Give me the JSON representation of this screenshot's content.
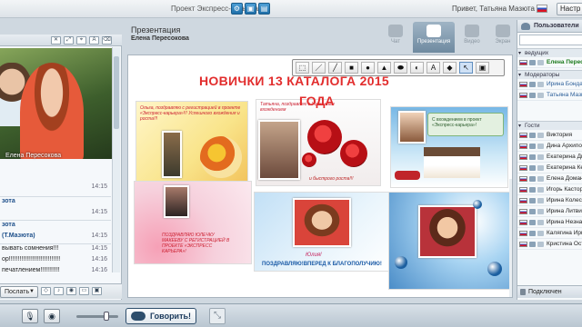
{
  "topbar": {
    "project": "Проект Экспресс-карьера",
    "greeting": "Привет, Татьяна Мазюта",
    "settings_label": "Настр",
    "buttons": [
      "gear-icon",
      "save-icon",
      "window-icon"
    ]
  },
  "left": {
    "video_caption": "Елена Пересокова",
    "send_label": "Послать",
    "chat": [
      {
        "text": "14:15",
        "kind": "time"
      },
      {
        "text": "зота",
        "kind": "b",
        "time": ""
      },
      {
        "text": "",
        "kind": "plain",
        "time": "14:15"
      },
      {
        "text": "зота",
        "kind": "b",
        "time": ""
      },
      {
        "text": "(Т.Мазюта)",
        "kind": "b",
        "time": "14:15"
      },
      {
        "text": "вывать сомнения!!!",
        "kind": "plain",
        "time": "14:15"
      },
      {
        "text": "ор!!!!!!!!!!!!!!!!!!!!!!!!!!!!!",
        "kind": "plain",
        "time": "14:16"
      },
      {
        "text": "печатлением!!!!!!!!!!!",
        "kind": "plain",
        "time": "14:16"
      }
    ]
  },
  "center": {
    "title": "Презентация",
    "presenter": "Елена Пересокова",
    "tabs": [
      {
        "label": "Чат",
        "icon": "chat-icon"
      },
      {
        "label": "Презентация",
        "icon": "presentation-icon"
      },
      {
        "label": "Видео",
        "icon": "video-icon"
      },
      {
        "label": "Экран",
        "icon": "screen-icon"
      }
    ],
    "headline": "НОВИЧКИ 13  КАТАЛОГА 2015",
    "headline2": "ГОДА",
    "card2_text": "Татьяна, поздравляю с Успешным вхождением",
    "card2_caption": "и быстрого роста!!!",
    "card1_text": "Ольга, поздравляю с регистрацией в проекте «Экспресс-карьера»!!! Успешного вхождения и роста!!!",
    "card4_text": "ПОЗДРАВЛЯЮ ЮЛЕЧКУ МАКЕЕВУ С РЕГИСТРАЦИЕЙ В ПРОЕКТЕ «ЭКСПРЕСС КАРЬЕРА»!",
    "card5_name": "Юлия!",
    "card5_bottom": "ПОЗДРАВЛЯЮ!ВПЕРЕД К БЛАГОПОЛУЧИЮ!",
    "card3_header": "С вхождением в проект «Экспресс-карьера»!"
  },
  "right": {
    "header": "Пользователи",
    "groups": {
      "leaders": "ведущих",
      "moderators": "Модераторы",
      "guests": "Гости"
    },
    "leaders": [
      "Елена Пересо"
    ],
    "moderators": [
      "Ирина Бондар",
      "Татьяна Мазю"
    ],
    "guests": [
      "Виктория",
      "Дина Архипов",
      "Екатерина Ди",
      "Екатерина Ке",
      "Елена Доманн",
      "Игорь Касторс",
      "Ирина Колесн",
      "Ирина Литвич",
      "Ирина Незнае",
      "Калягина Ири",
      "Кристина Ост"
    ],
    "connected": "Подключен"
  },
  "bottombar": {
    "talk_label": "Говорить!"
  }
}
